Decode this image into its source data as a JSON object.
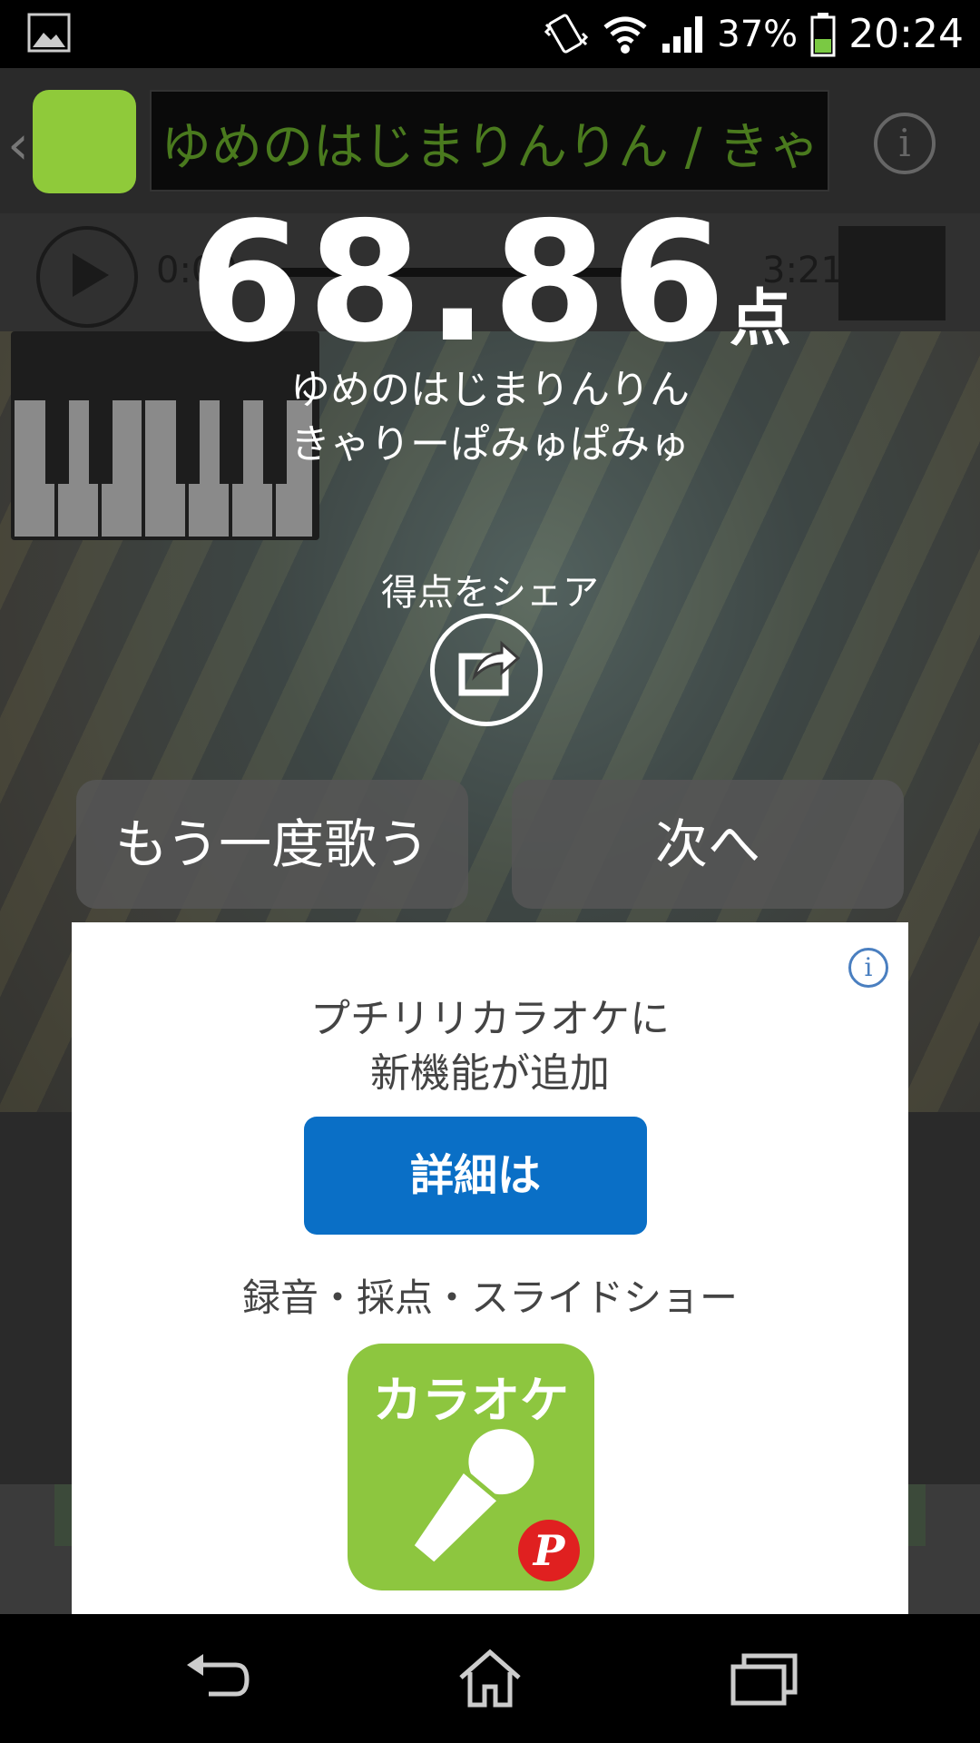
{
  "status_bar": {
    "battery_percent": "37%",
    "time": "20:24",
    "icons": [
      "gallery-notification-icon",
      "vibrate-icon",
      "wifi-icon",
      "signal-icon",
      "battery-icon"
    ]
  },
  "background_app": {
    "song_marquee": "ゆめのはじまりんりん / きゃり",
    "time_elapsed": "0:00",
    "time_total": "3:21"
  },
  "result": {
    "score_value": "68.86",
    "score_unit": "点",
    "song_title": "ゆめのはじまりんりん",
    "artist": "きゃりーぱみゅぱみゅ",
    "share_label": "得点をシェア"
  },
  "actions": {
    "retry_label": "もう一度歌う",
    "next_label": "次へ"
  },
  "ad": {
    "line1": "プチリリカラオケに",
    "line2": "新機能が追加",
    "cta_label": "詳細は",
    "features": "録音・採点・スライドショー",
    "logo_text": "カラオケ",
    "colors": {
      "cta": "#0a6fc6",
      "logo": "#8dc63f",
      "badge": "#e02020"
    }
  }
}
